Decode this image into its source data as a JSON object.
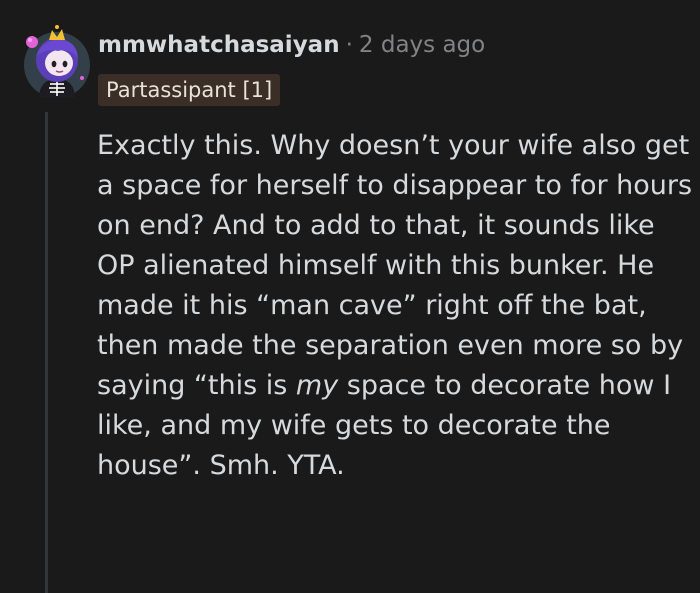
{
  "comment": {
    "author": "mmwhatchasaiyan",
    "separator": "·",
    "timestamp": "2 days ago",
    "flair": "Partassipant [1]",
    "avatar_icon": "snoo-avatar-icon",
    "body": {
      "before_emphasis": "Exactly this. Why doesn’t your wife also get a space for herself to disappear to for hours on end? And to add to that, it sounds like OP alienated himself with this bunker. He made it his “man cave” right off the bat, then made the separation even more so by saying “this is ",
      "emphasis": "my",
      "after_emphasis": " space to decorate how I like, and my wife gets to decorate the house”. Smh. YTA."
    }
  },
  "colors": {
    "background": "#1a1a1b",
    "text": "#d7dadc",
    "meta": "#818384",
    "flair_bg": "#3a2e26",
    "thread_line": "#343536",
    "avatar_circle": "#33404a",
    "avatar_hair": "#5b3fb8",
    "avatar_crown": "#f2c230",
    "avatar_bow": "#e064d6"
  }
}
